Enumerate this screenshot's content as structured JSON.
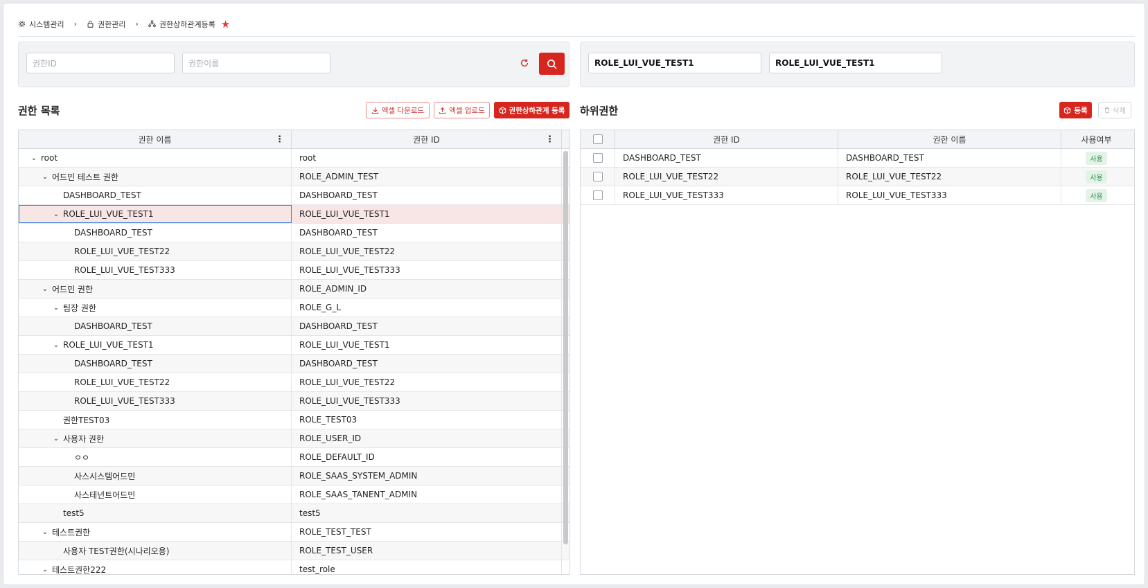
{
  "breadcrumb": [
    {
      "label": "시스템관리",
      "icon": "gear-icon"
    },
    {
      "label": "권한관리",
      "icon": "lock-icon"
    },
    {
      "label": "권한상하관계등록",
      "icon": "hierarchy-icon"
    }
  ],
  "search": {
    "role_id_placeholder": "권한ID",
    "role_name_placeholder": "권한이름"
  },
  "selected": {
    "role_id": "ROLE_LUI_VUE_TEST1",
    "role_name": "ROLE_LUI_VUE_TEST1"
  },
  "left_panel": {
    "title": "권한 목록",
    "excel_download": "엑셀 다운로드",
    "excel_upload": "엑셀 업로드",
    "register_relation": "권한상하관계 등록",
    "columns": [
      "권한 이름",
      "권한 ID"
    ],
    "rows": [
      {
        "name": "root",
        "id": "root"
      },
      {
        "name": "어드민 테스트 권한",
        "id": "ROLE_ADMIN_TEST"
      },
      {
        "name": "DASHBOARD_TEST",
        "id": "DASHBOARD_TEST"
      },
      {
        "name": "ROLE_LUI_VUE_TEST1",
        "id": "ROLE_LUI_VUE_TEST1"
      },
      {
        "name": "DASHBOARD_TEST",
        "id": "DASHBOARD_TEST"
      },
      {
        "name": "ROLE_LUI_VUE_TEST22",
        "id": "ROLE_LUI_VUE_TEST22"
      },
      {
        "name": "ROLE_LUI_VUE_TEST333",
        "id": "ROLE_LUI_VUE_TEST333"
      },
      {
        "name": "어드민 권한",
        "id": "ROLE_ADMIN_ID"
      },
      {
        "name": "팀장 권한",
        "id": "ROLE_G_L"
      },
      {
        "name": "DASHBOARD_TEST",
        "id": "DASHBOARD_TEST"
      },
      {
        "name": "ROLE_LUI_VUE_TEST1",
        "id": "ROLE_LUI_VUE_TEST1"
      },
      {
        "name": "DASHBOARD_TEST",
        "id": "DASHBOARD_TEST"
      },
      {
        "name": "ROLE_LUI_VUE_TEST22",
        "id": "ROLE_LUI_VUE_TEST22"
      },
      {
        "name": "ROLE_LUI_VUE_TEST333",
        "id": "ROLE_LUI_VUE_TEST333"
      },
      {
        "name": "권한TEST03",
        "id": "ROLE_TEST03"
      },
      {
        "name": "사용자 권한",
        "id": "ROLE_USER_ID"
      },
      {
        "name": "ㅇㅇ",
        "id": "ROLE_DEFAULT_ID"
      },
      {
        "name": "사스시스템어드민",
        "id": "ROLE_SAAS_SYSTEM_ADMIN"
      },
      {
        "name": "사스테넌트어드민",
        "id": "ROLE_SAAS_TANENT_ADMIN"
      },
      {
        "name": "test5",
        "id": "test5"
      },
      {
        "name": "테스트권한",
        "id": "ROLE_TEST_TEST"
      },
      {
        "name": "사용자 TEST권한(시나리오용)",
        "id": "ROLE_TEST_USER"
      },
      {
        "name": "테스트권한222",
        "id": "test_role"
      }
    ]
  },
  "right_panel": {
    "title": "하위권한",
    "register": "등록",
    "delete": "삭제",
    "columns": [
      "권한 ID",
      "권한 이름",
      "사용여부"
    ],
    "rows": [
      {
        "id": "DASHBOARD_TEST",
        "name": "DASHBOARD_TEST",
        "use": "사용"
      },
      {
        "id": "ROLE_LUI_VUE_TEST22",
        "name": "ROLE_LUI_VUE_TEST22",
        "use": "사용"
      },
      {
        "id": "ROLE_LUI_VUE_TEST333",
        "name": "ROLE_LUI_VUE_TEST333",
        "use": "사용"
      }
    ]
  },
  "colors": {
    "accent": "#d7261e",
    "selected_row": "#f8e6e6",
    "badge_green": "#2e8b4a"
  }
}
